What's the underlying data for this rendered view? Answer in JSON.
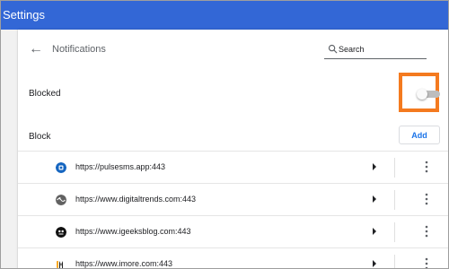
{
  "window": {
    "title": "Settings"
  },
  "header": {
    "title": "Notifications",
    "search_placeholder": "Search"
  },
  "blocked": {
    "label": "Blocked",
    "enabled": false
  },
  "block": {
    "label": "Block",
    "add_label": "Add"
  },
  "sites": [
    {
      "url": "https://pulsesms.app:443",
      "icon": "pulse-icon",
      "color": "#1565c0"
    },
    {
      "url": "https://www.digitaltrends.com:443",
      "icon": "globe-icon",
      "color": "#616161"
    },
    {
      "url": "https://www.igeeksblog.com:443",
      "icon": "igeeks-icon",
      "color": "#111111"
    },
    {
      "url": "https://www.imore.com:443",
      "icon": "imore-icon",
      "color": "#f9a825"
    }
  ],
  "colors": {
    "accent": "#3367d6",
    "highlight": "#f47a1f",
    "link": "#1a73e8"
  }
}
